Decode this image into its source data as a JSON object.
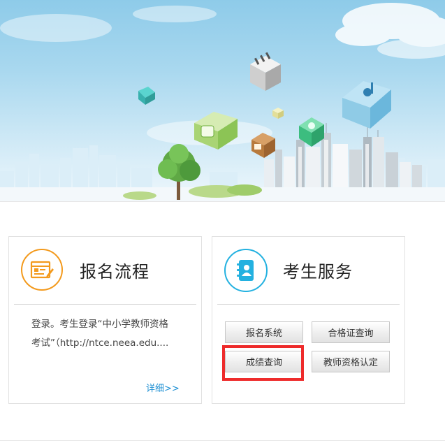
{
  "banner": {
    "icons": [
      "key-cube-icon",
      "piano-cube-icon",
      "music-cube-icon",
      "tv-cube-icon",
      "bulb-cube-icon",
      "clock-cube-icon",
      "film-cube-icon",
      "tree-icon",
      "city-skyline-icon",
      "cloud-icon"
    ]
  },
  "registration": {
    "icon": "form-edit-icon",
    "title": "报名流程",
    "text_line1": "登录。考生登录“中小学教师资格",
    "text_line2": "考试”（http://ntce.neea.edu....",
    "more_label": "详细>>"
  },
  "services": {
    "icon": "address-book-icon",
    "title": "考生服务",
    "buttons": [
      {
        "label": "报名系统"
      },
      {
        "label": "合格证查询"
      },
      {
        "label": "成绩查询"
      },
      {
        "label": "教师资格认定"
      }
    ],
    "highlighted": "成绩查询"
  },
  "colors": {
    "orange_accent": "#f39a1d",
    "blue_accent": "#23b1e0",
    "link_blue": "#1c8fd3",
    "highlight_red": "#ee2b2b"
  }
}
